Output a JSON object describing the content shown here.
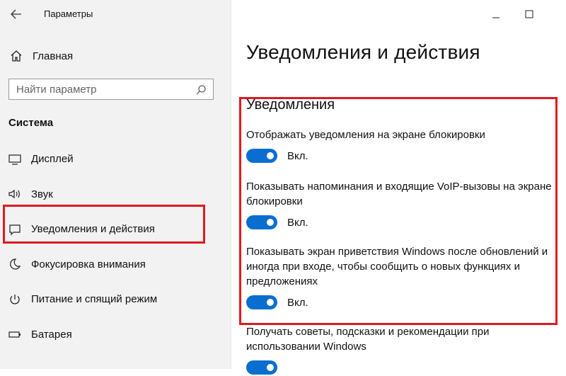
{
  "window": {
    "title": "Параметры",
    "controls": [
      "minimize-icon",
      "maximize-icon"
    ]
  },
  "sidebar": {
    "home_label": "Главная",
    "search_placeholder": "Найти параметр",
    "section_title": "Система",
    "items": [
      {
        "label": "Дисплей",
        "icon": "display-icon"
      },
      {
        "label": "Звук",
        "icon": "speaker-icon"
      },
      {
        "label": "Уведомления и действия",
        "icon": "notification-icon",
        "selected": true
      },
      {
        "label": "Фокусировка внимания",
        "icon": "moon-icon"
      },
      {
        "label": "Питание и спящий режим",
        "icon": "power-icon"
      },
      {
        "label": "Батарея",
        "icon": "battery-icon"
      }
    ]
  },
  "main": {
    "page_title": "Уведомления и действия",
    "section_heading": "Уведомления",
    "settings": [
      {
        "text": "Отображать уведомления на экране блокировки",
        "state": "Вкл."
      },
      {
        "text": "Показывать напоминания и входящие VoIP-вызовы на экране блокировки",
        "state": "Вкл."
      },
      {
        "text": "Показывать экран приветствия Windows после обновлений и иногда при входе, чтобы сообщить о новых функциях и предложениях",
        "state": "Вкл."
      },
      {
        "text": "Получать советы, подсказки и рекомендации при использовании Windows",
        "state": ""
      }
    ]
  },
  "colors": {
    "accent": "#0a6ed1",
    "highlight": "#e0191f",
    "sidebar_bg": "#f2f2f2"
  }
}
